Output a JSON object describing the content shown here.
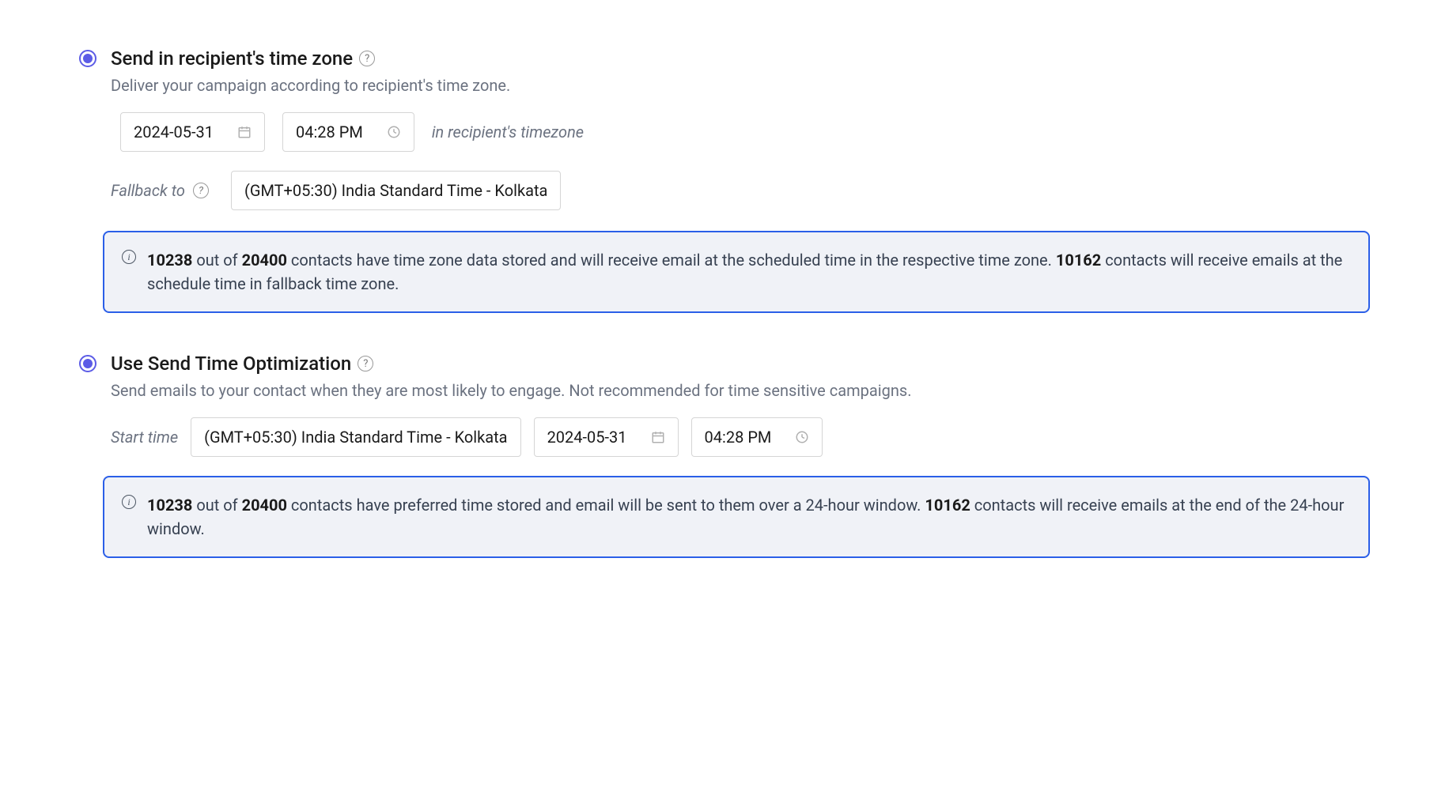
{
  "recipient_tz": {
    "title": "Send in recipient's time zone",
    "description": "Deliver your campaign according to recipient's time zone.",
    "date": "2024-05-31",
    "time": "04:28 PM",
    "hint": "in recipient's timezone",
    "fallback_label": "Fallback to",
    "fallback_tz": "(GMT+05:30) India Standard Time - Kolkata",
    "info": {
      "count_with_tz": "10238",
      "total": "20400",
      "text_mid": " out of ",
      "text_after_total": " contacts have time zone data stored and will receive email at the scheduled time in the respective time zone. ",
      "count_fallback": "10162",
      "text_end": " contacts will receive emails at the schedule time in fallback time zone."
    }
  },
  "send_time_opt": {
    "title": "Use Send Time Optimization",
    "description": "Send emails to your contact when they are most likely to engage. Not recommended for time sensitive campaigns.",
    "start_label": "Start time",
    "tz": "(GMT+05:30) India Standard Time - Kolkata",
    "date": "2024-05-31",
    "time": "04:28 PM",
    "info": {
      "count_with_pref": "10238",
      "total": "20400",
      "text_mid": " out of ",
      "text_after_total": " contacts have preferred time stored and email will be sent to them over a 24-hour window. ",
      "count_fallback": "10162",
      "text_end": " contacts will receive emails at the end of the 24-hour window."
    }
  }
}
